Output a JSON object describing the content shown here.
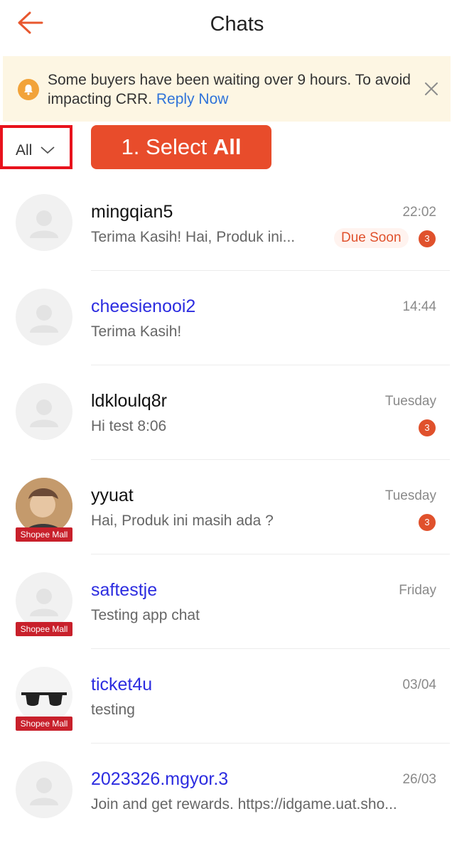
{
  "header": {
    "title": "Chats"
  },
  "notice": {
    "text": "Some buyers have been waiting over 9 hours. To avoid impacting CRR.",
    "link": "Reply Now"
  },
  "filter": {
    "label": "All"
  },
  "callout": {
    "prefix": "1. Select ",
    "bold": "All"
  },
  "chats": [
    {
      "name": "mingqian5",
      "time": "22:02",
      "preview": "Terima Kasih! Hai, Produk ini...",
      "badge": "Due Soon",
      "unread": "3"
    },
    {
      "name": "cheesienooi2",
      "time": "14:44",
      "preview": "Terima Kasih!"
    },
    {
      "name": "ldkloulq8r",
      "time": "Tuesday",
      "preview": "Hi test 8:06",
      "unread": "3"
    },
    {
      "name": "yyuat",
      "time": "Tuesday",
      "preview": "Hai, Produk ini masih ada ?",
      "unread": "3",
      "mall": "Shopee Mall"
    },
    {
      "name": "saftestje",
      "time": "Friday",
      "preview": "Testing app chat",
      "mall": "Shopee Mall"
    },
    {
      "name": "ticket4u",
      "time": "03/04",
      "preview": "testing",
      "mall": "Shopee Mall"
    },
    {
      "name": "2023326.mgyor.3",
      "time": "26/03",
      "preview": "Join and get rewards. https://idgame.uat.sho..."
    }
  ],
  "colors": {
    "accent": "#e84c2b",
    "link": "#2f73d9",
    "name_blue": "#2c2ce0",
    "banner_bg": "#fdf6e3"
  }
}
